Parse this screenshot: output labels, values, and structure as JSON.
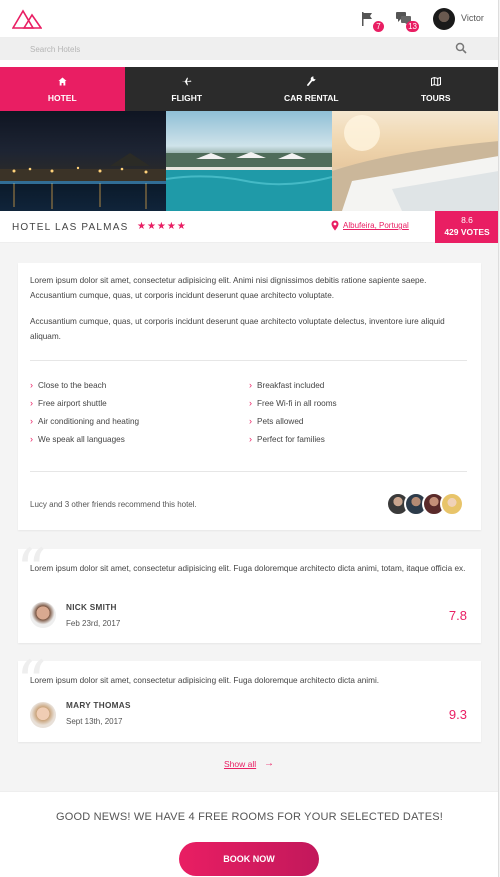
{
  "header": {
    "username": "Victor",
    "notifications": [
      {
        "icon": "flag-icon",
        "count": "7"
      },
      {
        "icon": "chat-icon",
        "count": "13"
      }
    ]
  },
  "search": {
    "placeholder": "Search Hotels"
  },
  "tabs": [
    {
      "label": "HOTEL",
      "icon": "home-icon",
      "active": true
    },
    {
      "label": "FLIGHT",
      "icon": "plane-icon",
      "active": false
    },
    {
      "label": "CAR RENTAL",
      "icon": "wrench-icon",
      "active": false
    },
    {
      "label": "TOURS",
      "icon": "map-icon",
      "active": false
    }
  ],
  "hotel": {
    "name": "HOTEL LAS PALMAS",
    "stars": 5,
    "stars_text": "★★★★★",
    "location": "Albufeira, Portugal",
    "rating": "8.6",
    "votes": "429 VOTES"
  },
  "description": {
    "paragraph1": "Lorem ipsum dolor sit amet, consectetur adipisicing elit. Animi nisi dignissimos debitis ratione sapiente saepe. Accusantium cumque, quas, ut corporis incidunt deserunt quae architecto voluptate.",
    "paragraph2": "Accusantium cumque, quas, ut corporis incidunt deserunt quae architecto voluptate delectus, inventore iure aliquid aliquam."
  },
  "amenities": {
    "left": [
      "Close to the beach",
      "Free airport shuttle",
      "Air conditioning and heating",
      "We speak all languages"
    ],
    "right": [
      "Breakfast included",
      "Free Wi-fi in all rooms",
      "Pets allowed",
      "Perfect for families"
    ]
  },
  "friends": {
    "text": "Lucy and 3 other friends recommend this hotel."
  },
  "reviews": [
    {
      "text": "Lorem ipsum dolor sit amet, consectetur adipisicing elit. Fuga doloremque architecto dicta animi, totam, itaque officia ex.",
      "name": "NICK SMITH",
      "date": "Feb 23rd, 2017",
      "score": "7.8"
    },
    {
      "text": "Lorem ipsum dolor sit amet, consectetur adipisicing elit. Fuga doloremque architecto dicta animi.",
      "name": "MARY THOMAS",
      "date": "Sept 13th, 2017",
      "score": "9.3"
    }
  ],
  "show_all": {
    "label": "Show all",
    "arrow": "→"
  },
  "booking": {
    "message": "GOOD NEWS! WE HAVE 4 FREE ROOMS FOR YOUR SELECTED DATES!",
    "button": "BOOK NOW"
  },
  "colors": {
    "accent": "#e91e63",
    "nav": "#2b2b2b"
  }
}
